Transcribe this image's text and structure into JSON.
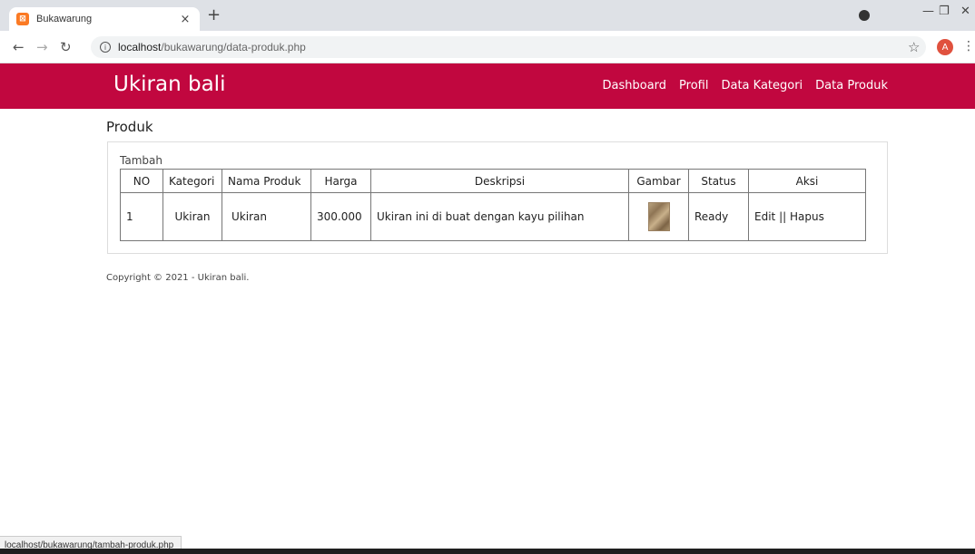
{
  "browser": {
    "tab_title": "Bukawarung",
    "tab_close": "×",
    "new_tab": "+",
    "url_host": "localhost",
    "url_path": "/bukawarung/data-produk.php",
    "avatar_letter": "A"
  },
  "site": {
    "brand": "Ukiran bali",
    "nav": [
      "Dashboard",
      "Profil",
      "Data Kategori",
      "Data Produk"
    ],
    "brand_color": "#c1073f"
  },
  "page": {
    "title": "Produk",
    "add_link": "Tambah",
    "table": {
      "headers": [
        "NO",
        "Kategori",
        "Nama Produk",
        "Harga",
        "Deskripsi",
        "Gambar",
        "Status",
        "Aksi"
      ],
      "rows": [
        {
          "no": "1",
          "kategori": "Ukiran",
          "nama": "Ukiran",
          "harga": "300.000",
          "deskripsi": "Ukiran ini di buat dengan kayu pilihan",
          "status": "Ready",
          "edit": "Edit",
          "sep": "||",
          "hapus": "Hapus"
        }
      ]
    },
    "footer": "Copyright © 2021 - Ukiran bali."
  },
  "status_bar_url": "localhost/bukawarung/tambah-produk.php"
}
